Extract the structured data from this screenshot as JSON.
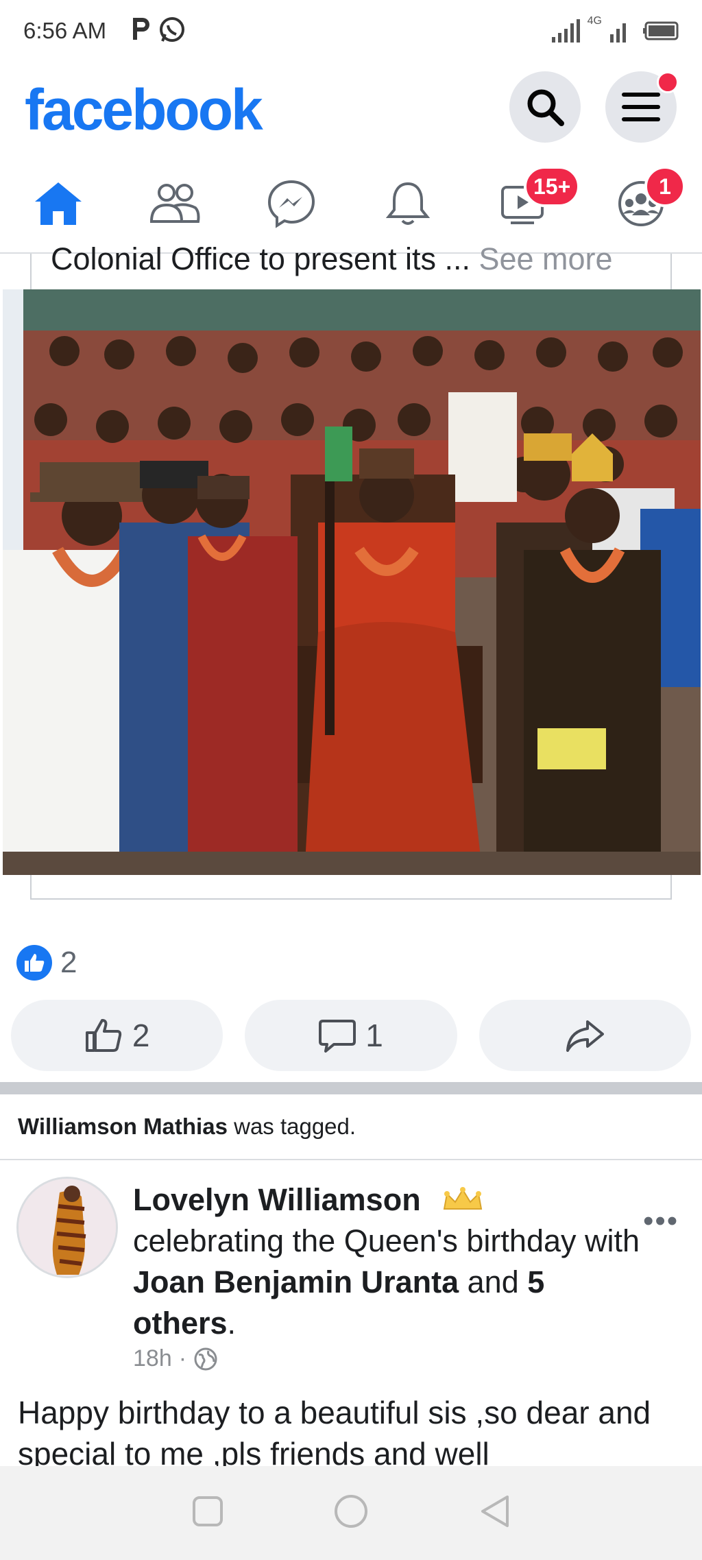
{
  "status_bar": {
    "time": "6:56 AM",
    "network": "4G",
    "icons": [
      "parking-icon",
      "whatsapp-icon",
      "signal-icon",
      "battery-icon"
    ]
  },
  "header": {
    "logo": "facebook",
    "brand_color": "#1877f2"
  },
  "nav": {
    "items": [
      {
        "name": "home",
        "icon": "home-icon",
        "active": true
      },
      {
        "name": "friends",
        "icon": "friends-icon"
      },
      {
        "name": "messenger",
        "icon": "messenger-icon"
      },
      {
        "name": "notifications",
        "icon": "bell-icon"
      },
      {
        "name": "watch",
        "icon": "video-icon",
        "badge": "15+"
      },
      {
        "name": "groups",
        "icon": "groups-icon",
        "badge": "1"
      }
    ]
  },
  "post1": {
    "text_snippet": "Colonial Office to present its ... ",
    "see_more": "See more",
    "reaction_count": "2",
    "like_label": "2",
    "comment_label": "1"
  },
  "post2": {
    "tagged_name": "Williamson Mathias",
    "tagged_suffix": " was tagged.",
    "author": "Lovelyn Williamson",
    "activity": "celebrating the Queen's birthday with",
    "with_person": "Joan Benjamin Uranta",
    "and_text": "and",
    "others": "5 others",
    "time": "18h",
    "dot": "·",
    "body": "Happy birthday  to a beautiful  sis ,so dear and special to me ,pls friends and well"
  }
}
